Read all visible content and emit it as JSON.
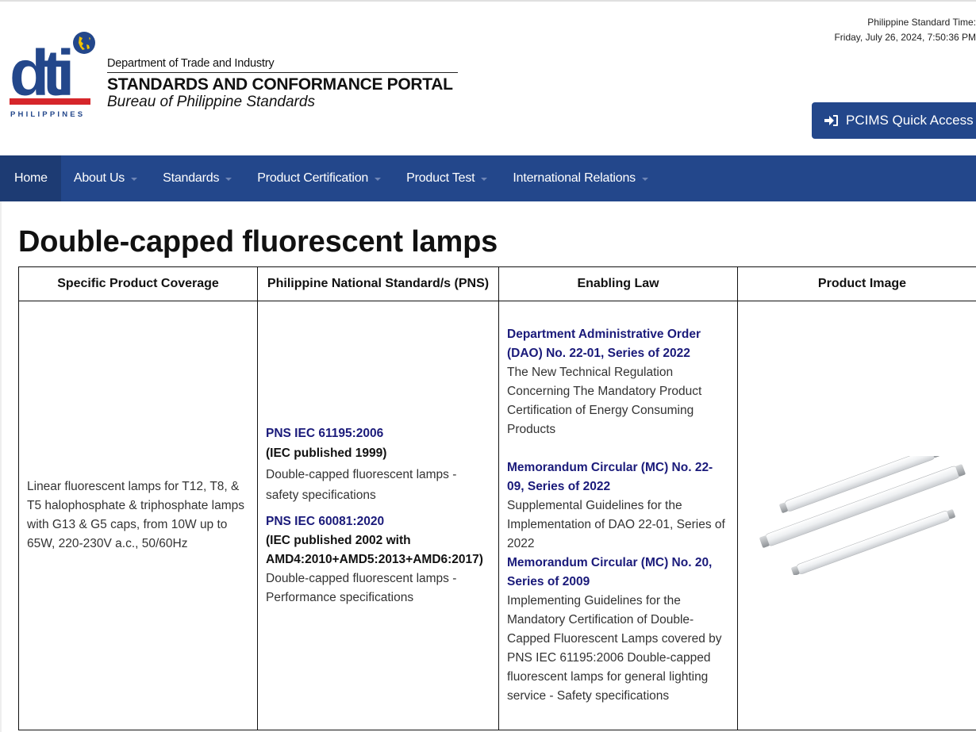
{
  "header": {
    "dept_name": "Department of Trade and Industry",
    "portal_name": "STANDARDS AND CONFORMANCE PORTAL",
    "bureau_name": "Bureau of Philippine Standards",
    "logo_text": "dti",
    "logo_country": "PHILIPPINES",
    "time_label": "Philippine Standard Time:",
    "time_value": "Friday, July 26, 2024, 7:50:36 PM",
    "quick_access_label": "PCIMS Quick Access"
  },
  "nav": {
    "items": [
      {
        "label": "Home"
      },
      {
        "label": "About Us"
      },
      {
        "label": "Standards"
      },
      {
        "label": "Product Certification"
      },
      {
        "label": "Product Test"
      },
      {
        "label": "International Relations"
      }
    ]
  },
  "page": {
    "title": "Double-capped fluorescent lamps"
  },
  "table": {
    "headers": [
      "Specific Product Coverage",
      "Philippine National Standard/s (PNS)",
      "Enabling Law",
      "Product Image"
    ],
    "coverage": "Linear fluorescent lamps for T12, T8, & T5 halophosphate & triphosphate lamps with G13 & G5 caps, from 10W up to 65W, 220-230V a.c., 50/60Hz",
    "standards": [
      {
        "code": "PNS IEC 61195:2006",
        "published": "(IEC published 1999)",
        "description": "Double-capped fluorescent lamps - safety specifications"
      },
      {
        "code": "PNS IEC 60081:2020",
        "published": "(IEC published 2002 with AMD4:2010+AMD5:2013+AMD6:2017)",
        "description": "Double-capped fluorescent lamps - Performance specifications"
      }
    ],
    "laws": [
      {
        "title": "Department Administrative Order (DAO) No. 22-01, Series of 2022",
        "description": "The New Technical Regulation Concerning The Mandatory Product Certification of Energy Consuming Products"
      },
      {
        "title": "Memorandum Circular (MC) No. 22-09, Series of 2022",
        "description": "Supplemental Guidelines for the Implementation of DAO 22-01, Series of 2022"
      },
      {
        "title": "Memorandum Circular (MC) No. 20, Series of 2009",
        "description": "Implementing Guidelines for the Mandatory Certification of Double-Capped Fluorescent Lamps covered by PNS IEC 61195:2006 Double-capped fluorescent lamps for general lighting service - Safety specifications"
      }
    ]
  },
  "colors": {
    "brand_blue": "#23478b",
    "nav_active": "#1d3b73",
    "link_navy": "#1a1a7a"
  }
}
